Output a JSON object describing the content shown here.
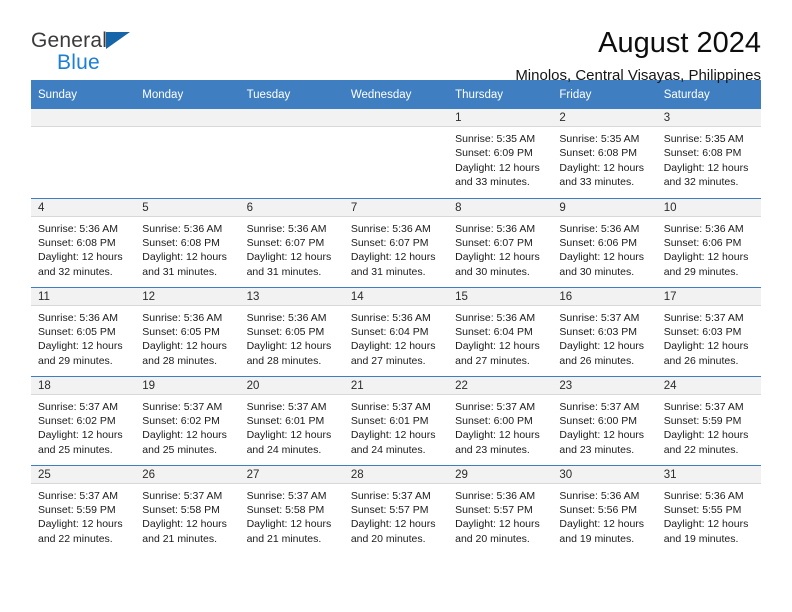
{
  "brand": {
    "line1": "General",
    "line2": "Blue",
    "triangle_color": "#1565a8"
  },
  "header": {
    "title": "August 2024",
    "subtitle": "Minolos, Central Visayas, Philippines"
  },
  "colors": {
    "header_blue": "#3f7fc1",
    "daynum_band": "#f2f2f2",
    "brand_blue": "#1c7fd6"
  },
  "labels": {
    "sunrise_prefix": "Sunrise:",
    "sunset_prefix": "Sunset:",
    "daylight_prefix": "Daylight:"
  },
  "weekday_headers": [
    "Sunday",
    "Monday",
    "Tuesday",
    "Wednesday",
    "Thursday",
    "Friday",
    "Saturday"
  ],
  "weeks": [
    [
      {
        "day": "",
        "line1": "",
        "line2": "",
        "line3": "",
        "line4": ""
      },
      {
        "day": "",
        "line1": "",
        "line2": "",
        "line3": "",
        "line4": ""
      },
      {
        "day": "",
        "line1": "",
        "line2": "",
        "line3": "",
        "line4": ""
      },
      {
        "day": "",
        "line1": "",
        "line2": "",
        "line3": "",
        "line4": ""
      },
      {
        "day": "1",
        "line1": "Sunrise: 5:35 AM",
        "line2": "Sunset: 6:09 PM",
        "line3": "Daylight: 12 hours",
        "line4": "and 33 minutes."
      },
      {
        "day": "2",
        "line1": "Sunrise: 5:35 AM",
        "line2": "Sunset: 6:08 PM",
        "line3": "Daylight: 12 hours",
        "line4": "and 33 minutes."
      },
      {
        "day": "3",
        "line1": "Sunrise: 5:35 AM",
        "line2": "Sunset: 6:08 PM",
        "line3": "Daylight: 12 hours",
        "line4": "and 32 minutes."
      }
    ],
    [
      {
        "day": "4",
        "line1": "Sunrise: 5:36 AM",
        "line2": "Sunset: 6:08 PM",
        "line3": "Daylight: 12 hours",
        "line4": "and 32 minutes."
      },
      {
        "day": "5",
        "line1": "Sunrise: 5:36 AM",
        "line2": "Sunset: 6:08 PM",
        "line3": "Daylight: 12 hours",
        "line4": "and 31 minutes."
      },
      {
        "day": "6",
        "line1": "Sunrise: 5:36 AM",
        "line2": "Sunset: 6:07 PM",
        "line3": "Daylight: 12 hours",
        "line4": "and 31 minutes."
      },
      {
        "day": "7",
        "line1": "Sunrise: 5:36 AM",
        "line2": "Sunset: 6:07 PM",
        "line3": "Daylight: 12 hours",
        "line4": "and 31 minutes."
      },
      {
        "day": "8",
        "line1": "Sunrise: 5:36 AM",
        "line2": "Sunset: 6:07 PM",
        "line3": "Daylight: 12 hours",
        "line4": "and 30 minutes."
      },
      {
        "day": "9",
        "line1": "Sunrise: 5:36 AM",
        "line2": "Sunset: 6:06 PM",
        "line3": "Daylight: 12 hours",
        "line4": "and 30 minutes."
      },
      {
        "day": "10",
        "line1": "Sunrise: 5:36 AM",
        "line2": "Sunset: 6:06 PM",
        "line3": "Daylight: 12 hours",
        "line4": "and 29 minutes."
      }
    ],
    [
      {
        "day": "11",
        "line1": "Sunrise: 5:36 AM",
        "line2": "Sunset: 6:05 PM",
        "line3": "Daylight: 12 hours",
        "line4": "and 29 minutes."
      },
      {
        "day": "12",
        "line1": "Sunrise: 5:36 AM",
        "line2": "Sunset: 6:05 PM",
        "line3": "Daylight: 12 hours",
        "line4": "and 28 minutes."
      },
      {
        "day": "13",
        "line1": "Sunrise: 5:36 AM",
        "line2": "Sunset: 6:05 PM",
        "line3": "Daylight: 12 hours",
        "line4": "and 28 minutes."
      },
      {
        "day": "14",
        "line1": "Sunrise: 5:36 AM",
        "line2": "Sunset: 6:04 PM",
        "line3": "Daylight: 12 hours",
        "line4": "and 27 minutes."
      },
      {
        "day": "15",
        "line1": "Sunrise: 5:36 AM",
        "line2": "Sunset: 6:04 PM",
        "line3": "Daylight: 12 hours",
        "line4": "and 27 minutes."
      },
      {
        "day": "16",
        "line1": "Sunrise: 5:37 AM",
        "line2": "Sunset: 6:03 PM",
        "line3": "Daylight: 12 hours",
        "line4": "and 26 minutes."
      },
      {
        "day": "17",
        "line1": "Sunrise: 5:37 AM",
        "line2": "Sunset: 6:03 PM",
        "line3": "Daylight: 12 hours",
        "line4": "and 26 minutes."
      }
    ],
    [
      {
        "day": "18",
        "line1": "Sunrise: 5:37 AM",
        "line2": "Sunset: 6:02 PM",
        "line3": "Daylight: 12 hours",
        "line4": "and 25 minutes."
      },
      {
        "day": "19",
        "line1": "Sunrise: 5:37 AM",
        "line2": "Sunset: 6:02 PM",
        "line3": "Daylight: 12 hours",
        "line4": "and 25 minutes."
      },
      {
        "day": "20",
        "line1": "Sunrise: 5:37 AM",
        "line2": "Sunset: 6:01 PM",
        "line3": "Daylight: 12 hours",
        "line4": "and 24 minutes."
      },
      {
        "day": "21",
        "line1": "Sunrise: 5:37 AM",
        "line2": "Sunset: 6:01 PM",
        "line3": "Daylight: 12 hours",
        "line4": "and 24 minutes."
      },
      {
        "day": "22",
        "line1": "Sunrise: 5:37 AM",
        "line2": "Sunset: 6:00 PM",
        "line3": "Daylight: 12 hours",
        "line4": "and 23 minutes."
      },
      {
        "day": "23",
        "line1": "Sunrise: 5:37 AM",
        "line2": "Sunset: 6:00 PM",
        "line3": "Daylight: 12 hours",
        "line4": "and 23 minutes."
      },
      {
        "day": "24",
        "line1": "Sunrise: 5:37 AM",
        "line2": "Sunset: 5:59 PM",
        "line3": "Daylight: 12 hours",
        "line4": "and 22 minutes."
      }
    ],
    [
      {
        "day": "25",
        "line1": "Sunrise: 5:37 AM",
        "line2": "Sunset: 5:59 PM",
        "line3": "Daylight: 12 hours",
        "line4": "and 22 minutes."
      },
      {
        "day": "26",
        "line1": "Sunrise: 5:37 AM",
        "line2": "Sunset: 5:58 PM",
        "line3": "Daylight: 12 hours",
        "line4": "and 21 minutes."
      },
      {
        "day": "27",
        "line1": "Sunrise: 5:37 AM",
        "line2": "Sunset: 5:58 PM",
        "line3": "Daylight: 12 hours",
        "line4": "and 21 minutes."
      },
      {
        "day": "28",
        "line1": "Sunrise: 5:37 AM",
        "line2": "Sunset: 5:57 PM",
        "line3": "Daylight: 12 hours",
        "line4": "and 20 minutes."
      },
      {
        "day": "29",
        "line1": "Sunrise: 5:36 AM",
        "line2": "Sunset: 5:57 PM",
        "line3": "Daylight: 12 hours",
        "line4": "and 20 minutes."
      },
      {
        "day": "30",
        "line1": "Sunrise: 5:36 AM",
        "line2": "Sunset: 5:56 PM",
        "line3": "Daylight: 12 hours",
        "line4": "and 19 minutes."
      },
      {
        "day": "31",
        "line1": "Sunrise: 5:36 AM",
        "line2": "Sunset: 5:55 PM",
        "line3": "Daylight: 12 hours",
        "line4": "and 19 minutes."
      }
    ]
  ]
}
